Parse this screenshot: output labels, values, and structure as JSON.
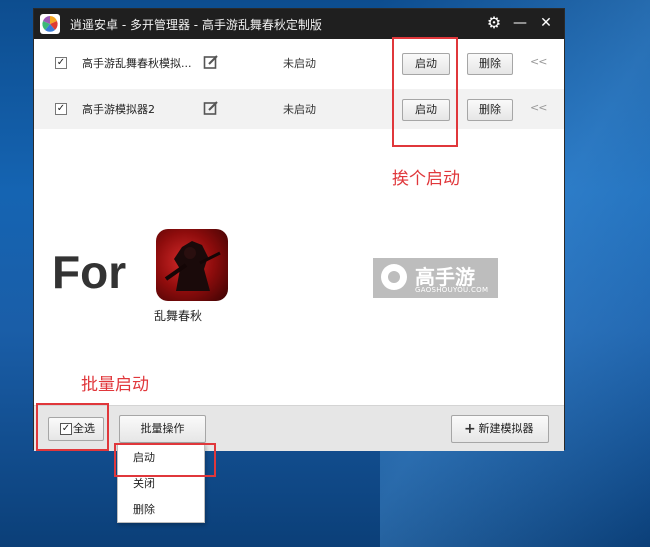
{
  "window": {
    "title": "逍遥安卓 - 多开管理器 - 高手游乱舞春秋定制版",
    "controls": {
      "settings": "⚙",
      "minimize": "—",
      "close": "✕"
    }
  },
  "instances": [
    {
      "name": "高手游乱舞春秋模拟...",
      "status": "未启动",
      "start_label": "启动",
      "delete_label": "删除",
      "checked": true
    },
    {
      "name": "高手游模拟器2",
      "status": "未启动",
      "start_label": "启动",
      "delete_label": "删除",
      "checked": true
    }
  ],
  "row_more": "<<",
  "annotations": {
    "one_by_one": "挨个启动",
    "batch": "批量启动"
  },
  "promo": {
    "for_text": "For",
    "game_name": "乱舞春秋",
    "brand_name": "高手游",
    "brand_url": "GAOSHOUYOU.COM"
  },
  "bottom": {
    "select_all_label": "全选",
    "batch_label": "批量操作",
    "new_label": "新建模拟器",
    "new_icon": "+"
  },
  "dropdown": {
    "items": [
      "启动",
      "关闭",
      "删除"
    ]
  },
  "colors": {
    "annotation_red": "#e0373b",
    "titlebar": "#1f1f1f",
    "desktop": "#1564b2"
  }
}
